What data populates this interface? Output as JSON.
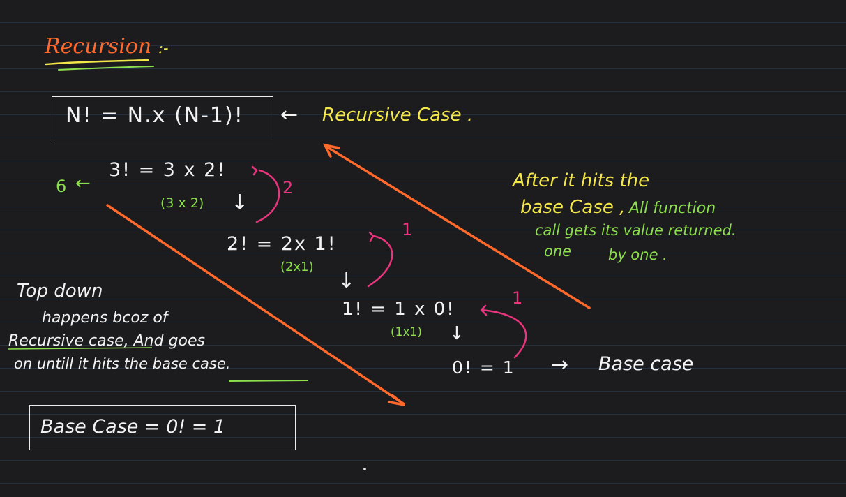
{
  "title": "Recursion",
  "title_suffix": ":-",
  "recursive_case": {
    "formula": "N! = N.x (N-1)!",
    "arrow": "←",
    "label": "Recursive Case ."
  },
  "steps": {
    "s1_result": "6",
    "s1_result_arrow": "←",
    "s1_expr": "3! = 3 x 2!",
    "s1_sub": "(3 x 2)",
    "s1_return": "2",
    "s2_expr": "2! = 2x 1!",
    "s2_sub": "(2x1)",
    "s2_return": "1",
    "s3_expr": "1! = 1 x 0!",
    "s3_sub": "(1x1)",
    "s3_return": "1",
    "s4_expr": "0! = 1",
    "down_arrow": "↓"
  },
  "base_case_pointer": {
    "arrow": "→",
    "label": "Base case"
  },
  "note_right": {
    "line1": "After it hits the",
    "line2_a": "base Case ,",
    "line2_b": "All function",
    "line3": "call gets its value returned.",
    "line4_a": "one",
    "line4_b": "by one ."
  },
  "note_left": {
    "line1": "Top down",
    "line2": "happens bcoz of",
    "line3": "Recursive case, And goes",
    "line4": "on untill it hits the base case."
  },
  "base_case_box": {
    "text": "Base Case  =  0! = 1"
  },
  "colors": {
    "background": "#1c1c1e",
    "rule_lines": "#23303f",
    "pen_white": "#f2f2f2",
    "pen_yellow": "#f4e74a",
    "pen_green": "#8de04d",
    "pen_magenta": "#e8357d",
    "pen_orange": "#ff6a2c"
  }
}
